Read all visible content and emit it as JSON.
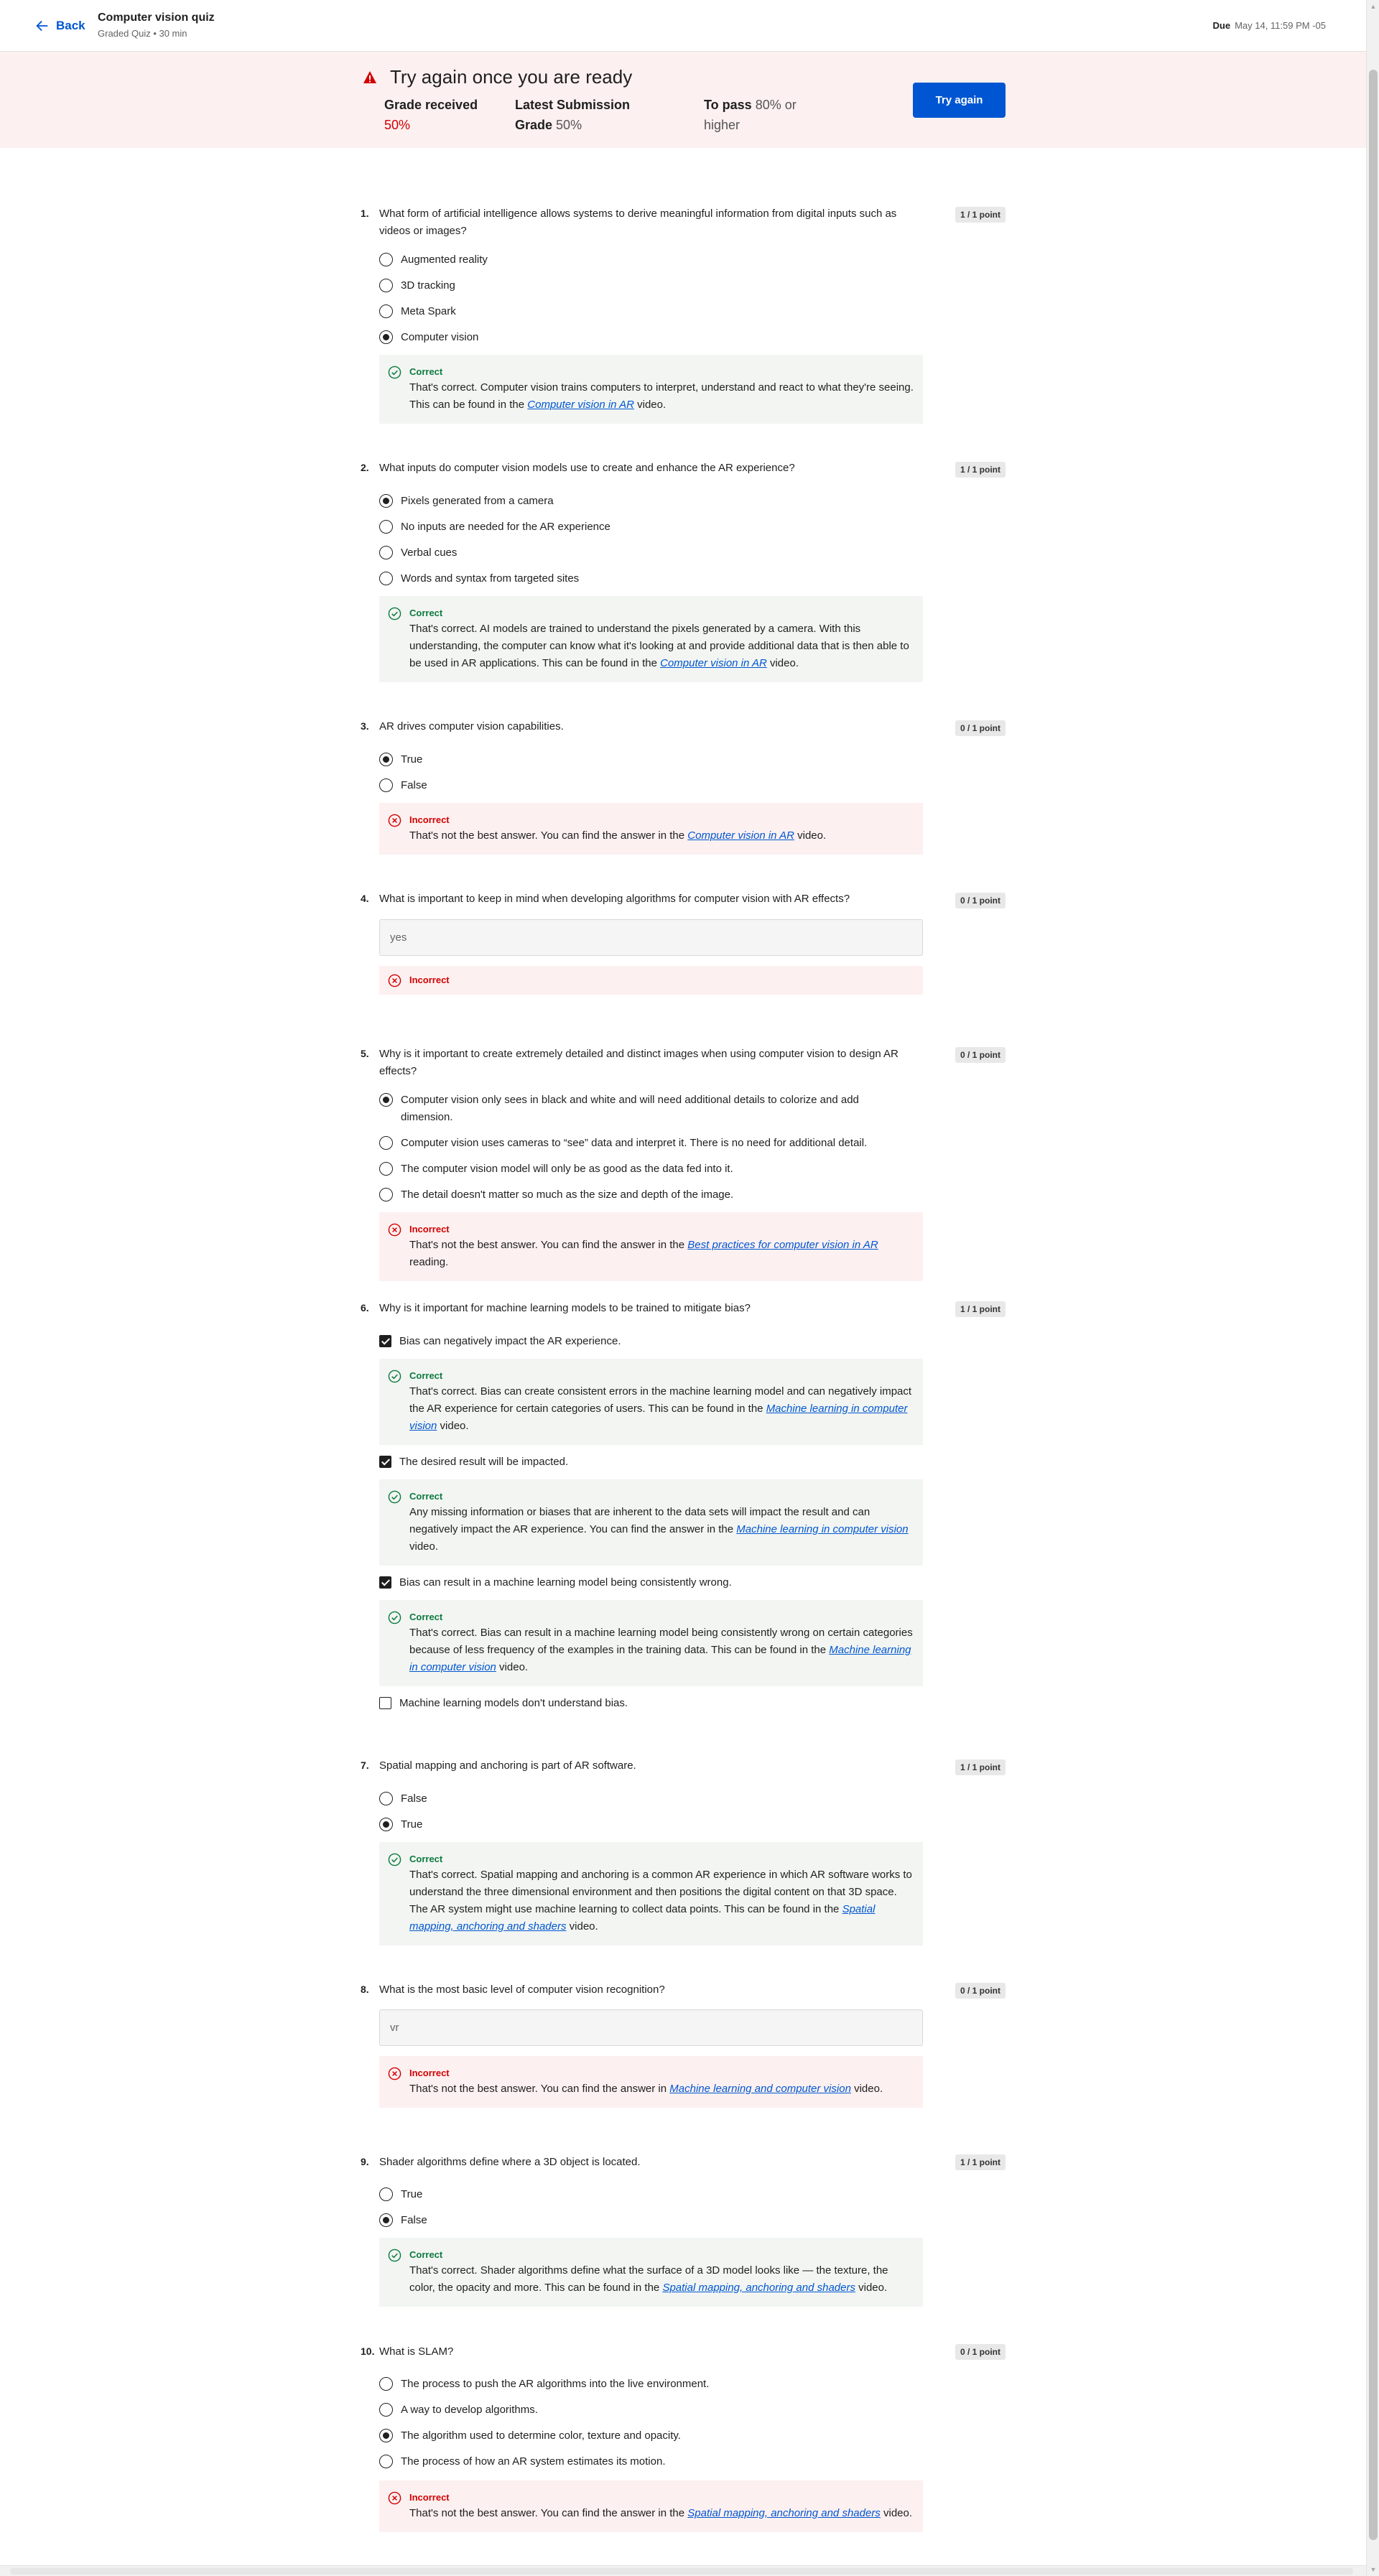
{
  "header": {
    "back_label": "Back",
    "title": "Computer vision quiz",
    "subtitle": "Graded Quiz • 30 min",
    "due_label": "Due",
    "due_value": "May 14, 11:59 PM -05"
  },
  "banner": {
    "title": "Try again once you are ready",
    "grade_label": "Grade received",
    "grade_value": "50%",
    "latest_label": "Latest Submission Grade",
    "latest_value": "50%",
    "pass_label": "To pass",
    "pass_value": "80% or higher",
    "try_again": "Try again"
  },
  "colors": {
    "accent": "#0056d2",
    "correct": "#0d7a3f",
    "incorrect": "#d30001"
  },
  "questions": [
    {
      "num": "1.",
      "text": "What form of artificial intelligence allows systems to derive meaningful information from digital inputs such as videos or images?",
      "points": "1 / 1 point",
      "options": [
        "Augmented reality",
        "3D tracking",
        "Meta Spark",
        "Computer vision"
      ],
      "feedback": [
        {
          "status": "Correct",
          "pre": "That's correct. Computer vision trains computers to interpret, understand and react to what they're seeing. This can be found in the ",
          "link": "Computer vision in AR",
          "post": " video."
        }
      ]
    },
    {
      "num": "2.",
      "text": "What inputs do computer vision models use to create and enhance the AR experience?",
      "points": "1 / 1 point",
      "options": [
        "Pixels generated from a camera",
        "No inputs are needed for the AR experience",
        "Verbal cues",
        "Words and syntax from targeted sites"
      ],
      "feedback": [
        {
          "status": "Correct",
          "pre": "That's correct. AI models are trained to understand the pixels generated by a camera. With this understanding, the computer can know what it's looking at and provide additional data that is then able to be used in AR applications. This can be found in the ",
          "link": "Computer vision in AR",
          "post": " video."
        }
      ]
    },
    {
      "num": "3.",
      "text": "AR drives computer vision capabilities.",
      "points": "0 / 1 point",
      "options": [
        "True",
        "False"
      ],
      "feedback": [
        {
          "status": "Incorrect",
          "pre": "That's not the best answer. You can find the answer in the ",
          "link": "Computer vision in AR",
          "post": " video."
        }
      ]
    },
    {
      "num": "4.",
      "text": "What is important to keep in mind when developing algorithms for computer vision with AR effects?",
      "points": "0 / 1 point",
      "answer": "yes",
      "feedback": [
        {
          "status": "Incorrect"
        }
      ]
    },
    {
      "num": "5.",
      "text": "Why is it important to create extremely detailed and distinct images when using computer vision to design AR effects?",
      "points": "0 / 1 point",
      "options": [
        "Computer vision only sees in black and white and will need additional details to colorize and add dimension.",
        "Computer vision uses cameras to “see” data and interpret it. There is no need for additional detail.",
        "The computer vision model will only be as good as the data fed into it.",
        "The detail doesn't matter so much as the size and depth of the image."
      ],
      "feedback": [
        {
          "status": "Incorrect",
          "pre": "That's not the best answer. You can find the answer in the ",
          "link": "Best practices for computer vision in AR",
          "post": " reading."
        }
      ]
    },
    {
      "num": "6.",
      "text": "Why is it important for machine learning models to be trained to mitigate bias?",
      "points": "1 / 1 point",
      "options": [
        "Bias can negatively impact the AR experience.",
        "The desired result will be impacted.",
        "Bias can result in a machine learning model being consistently wrong.",
        "Machine learning models don't understand bias."
      ],
      "feedback": [
        {
          "status": "Correct",
          "pre": "That's correct. Bias can create consistent errors in the machine learning model and can negatively impact the AR experience for certain categories of users. This can be found in the ",
          "link": "Machine learning in computer vision",
          "post": " video."
        },
        {
          "status": "Correct",
          "pre": "Any missing information or biases that are inherent to the data sets will impact the result and can negatively impact the AR experience. You can find the answer in the ",
          "link": "Machine learning in computer vision",
          "post": " video."
        },
        {
          "status": "Correct",
          "pre": "That's correct. Bias can result in a machine learning model being consistently wrong on certain categories because of less frequency of the examples in the training data. This can be found in the ",
          "link": "Machine learning in computer vision",
          "post": " video."
        }
      ]
    },
    {
      "num": "7.",
      "text": "Spatial mapping and anchoring is part of AR software.",
      "points": "1 / 1 point",
      "options": [
        "False",
        "True"
      ],
      "feedback": [
        {
          "status": "Correct",
          "pre": "That's correct. Spatial mapping and anchoring is a common AR experience in which AR software works to understand the three dimensional environment and then positions the digital content on that 3D space. The AR system might use machine learning to collect data points. This can be found in the ",
          "link": "Spatial mapping, anchoring and shaders",
          "post": " video."
        }
      ]
    },
    {
      "num": "8.",
      "text": "What is the most basic level of computer vision recognition?",
      "points": "0 / 1 point",
      "answer": "vr",
      "feedback": [
        {
          "status": "Incorrect",
          "pre": "That's not the best answer. You can find the answer in ",
          "link": "Machine learning and computer vision",
          "post": " video."
        }
      ]
    },
    {
      "num": "9.",
      "text": "Shader algorithms define where a 3D object is located.",
      "points": "1 / 1 point",
      "options": [
        "True",
        "False"
      ],
      "feedback": [
        {
          "status": "Correct",
          "pre": "That's correct. Shader algorithms define what the surface of a 3D model looks like — the texture, the color, the opacity and more. This can be found in the ",
          "link": "Spatial mapping, anchoring and shaders",
          "post": " video."
        }
      ]
    },
    {
      "num": "10.",
      "text": "What is SLAM?",
      "points": "0 / 1 point",
      "options": [
        "The process to push the AR algorithms into the live environment.",
        "A way to develop algorithms.",
        "The algorithm used to determine color, texture and opacity.",
        "The process of how an AR system estimates its motion."
      ],
      "feedback": [
        {
          "status": "Incorrect",
          "pre": "That's not the best answer. You can find the answer in the ",
          "link": "Spatial mapping, anchoring and shaders",
          "post": " video."
        }
      ]
    }
  ]
}
